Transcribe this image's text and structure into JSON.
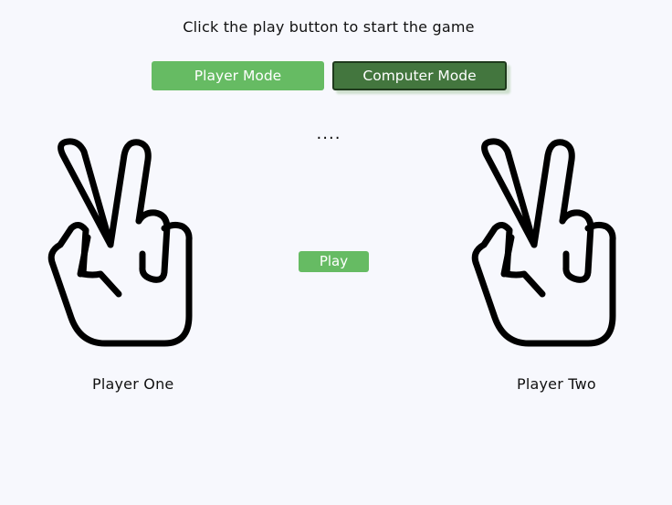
{
  "instruction": "Click the play button to start the game",
  "modes": {
    "player_mode_label": "Player Mode",
    "computer_mode_label": "Computer Mode",
    "selected": "Computer Mode"
  },
  "result_text": "....",
  "play_label": "Play",
  "players": {
    "one": {
      "label": "Player One",
      "hand": "scissors-hand-icon"
    },
    "two": {
      "label": "Player Two",
      "hand": "scissors-hand-icon"
    }
  },
  "colors": {
    "background": "#f7f8fd",
    "button_green": "#66bb63",
    "button_dark_green": "#43763e"
  }
}
